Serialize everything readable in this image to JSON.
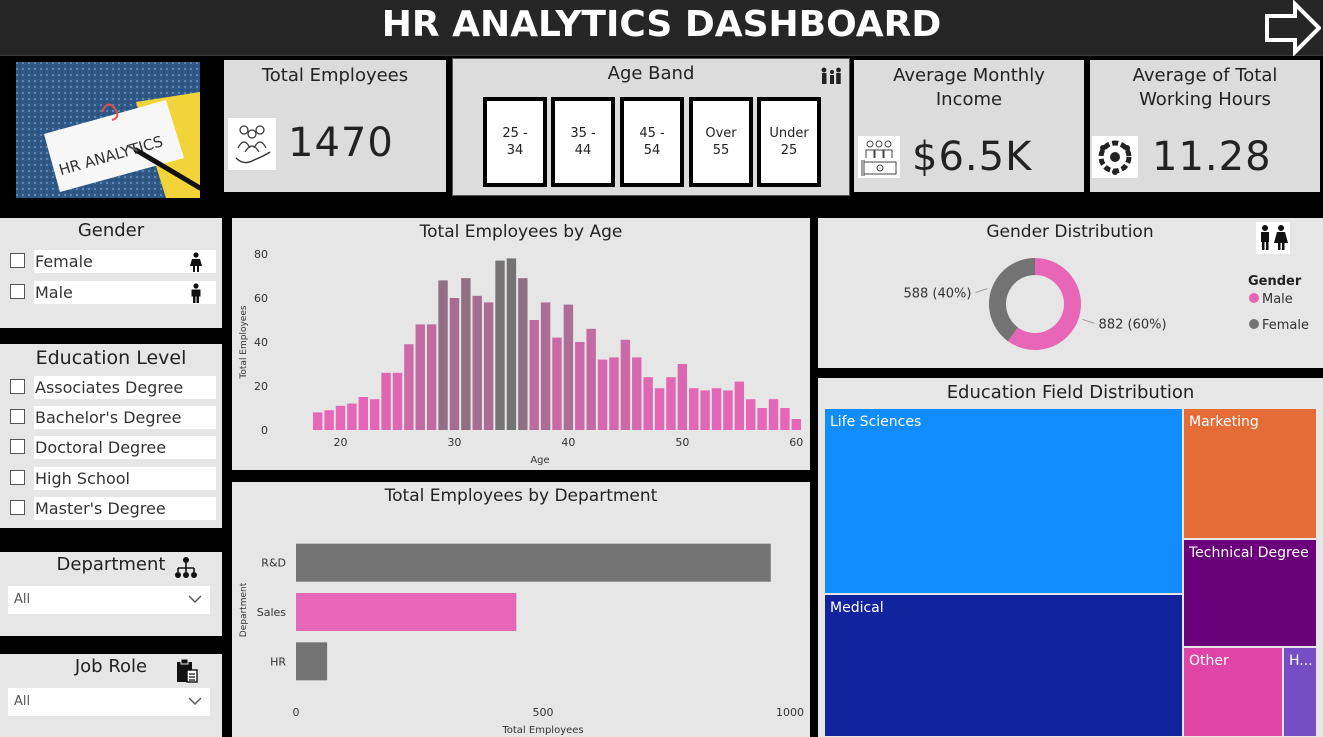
{
  "header": {
    "title": "HR ANALYTICS DASHBOARD"
  },
  "logo_card": {
    "note_text": "HR ANALYTICS"
  },
  "kpis": {
    "total_employees": {
      "label": "Total Employees",
      "value": "1470",
      "icon": "employees-icon"
    },
    "avg_income": {
      "label": "Average Monthly Income",
      "value": "$6.5K",
      "icon": "money-icon"
    },
    "avg_hours": {
      "label": "Average of Total Working Hours",
      "value": "11.28",
      "icon": "gear-people-icon"
    }
  },
  "age_band": {
    "label": "Age Band",
    "tiles": [
      "25 -\n34",
      "35 -\n44",
      "45 -\n54",
      "Over\n55",
      "Under\n25"
    ]
  },
  "slicers": {
    "gender": {
      "title": "Gender",
      "items": [
        {
          "label": "Female",
          "icon": "female-icon"
        },
        {
          "label": "Male",
          "icon": "male-icon"
        }
      ]
    },
    "education": {
      "title": "Education Level",
      "items": [
        "Associates Degree",
        "Bachelor's Degree",
        "Doctoral Degree",
        "High School",
        "Master's Degree"
      ]
    },
    "department": {
      "title": "Department",
      "selected": "All",
      "icon": "org-chart-icon"
    },
    "job_role": {
      "title": "Job Role",
      "selected": "All",
      "icon": "clipboard-icon"
    }
  },
  "colors": {
    "pink": "#e866b8",
    "gray": "#737373",
    "dark": "#262626",
    "panel": "#e6e6e6"
  },
  "chart_data": [
    {
      "id": "age",
      "type": "bar",
      "title": "Total Employees by Age",
      "xlabel": "Age",
      "ylabel": "Total Employees",
      "ylim": [
        0,
        80
      ],
      "yticks": [
        0,
        20,
        40,
        60,
        80
      ],
      "xticks": [
        20,
        30,
        40,
        50,
        60
      ],
      "x": [
        18,
        19,
        20,
        21,
        22,
        23,
        24,
        25,
        26,
        27,
        28,
        29,
        30,
        31,
        32,
        33,
        34,
        35,
        36,
        37,
        38,
        39,
        40,
        41,
        42,
        43,
        44,
        45,
        46,
        47,
        48,
        49,
        50,
        51,
        52,
        53,
        54,
        55,
        56,
        57,
        58,
        59,
        60
      ],
      "values": [
        8,
        9,
        11,
        12,
        15,
        14,
        26,
        26,
        39,
        48,
        48,
        68,
        60,
        69,
        61,
        58,
        77,
        78,
        69,
        50,
        58,
        42,
        57,
        40,
        46,
        32,
        33,
        41,
        33,
        24,
        19,
        24,
        30,
        19,
        18,
        19,
        18,
        22,
        14,
        10,
        14,
        10,
        5
      ]
    },
    {
      "id": "department",
      "type": "bar",
      "orientation": "horizontal",
      "title": "Total Employees by Department",
      "xlabel": "Total Employees",
      "ylabel": "Department",
      "xlim": [
        0,
        1000
      ],
      "xticks": [
        0,
        500,
        1000
      ],
      "categories": [
        "R&D",
        "Sales",
        "HR"
      ],
      "values": [
        961,
        446,
        63
      ]
    },
    {
      "id": "gender",
      "type": "pie",
      "donut": true,
      "title": "Gender Distribution",
      "legend_title": "Gender",
      "legend_position": "right",
      "slices": [
        {
          "name": "Male",
          "value": 882,
          "label": "882 (60%)",
          "color": "#e866b8"
        },
        {
          "name": "Female",
          "value": 588,
          "label": "588 (40%)",
          "color": "#737373"
        }
      ]
    },
    {
      "id": "education_field",
      "type": "treemap",
      "title": "Education Field Distribution",
      "items": [
        {
          "name": "Life Sciences",
          "color": "#118dff"
        },
        {
          "name": "Medical",
          "color": "#12239e"
        },
        {
          "name": "Marketing",
          "color": "#e66c37"
        },
        {
          "name": "Technical Degree",
          "color": "#6b007b"
        },
        {
          "name": "Other",
          "color": "#e044a7"
        },
        {
          "name": "H...",
          "color": "#744ec2"
        }
      ]
    }
  ]
}
